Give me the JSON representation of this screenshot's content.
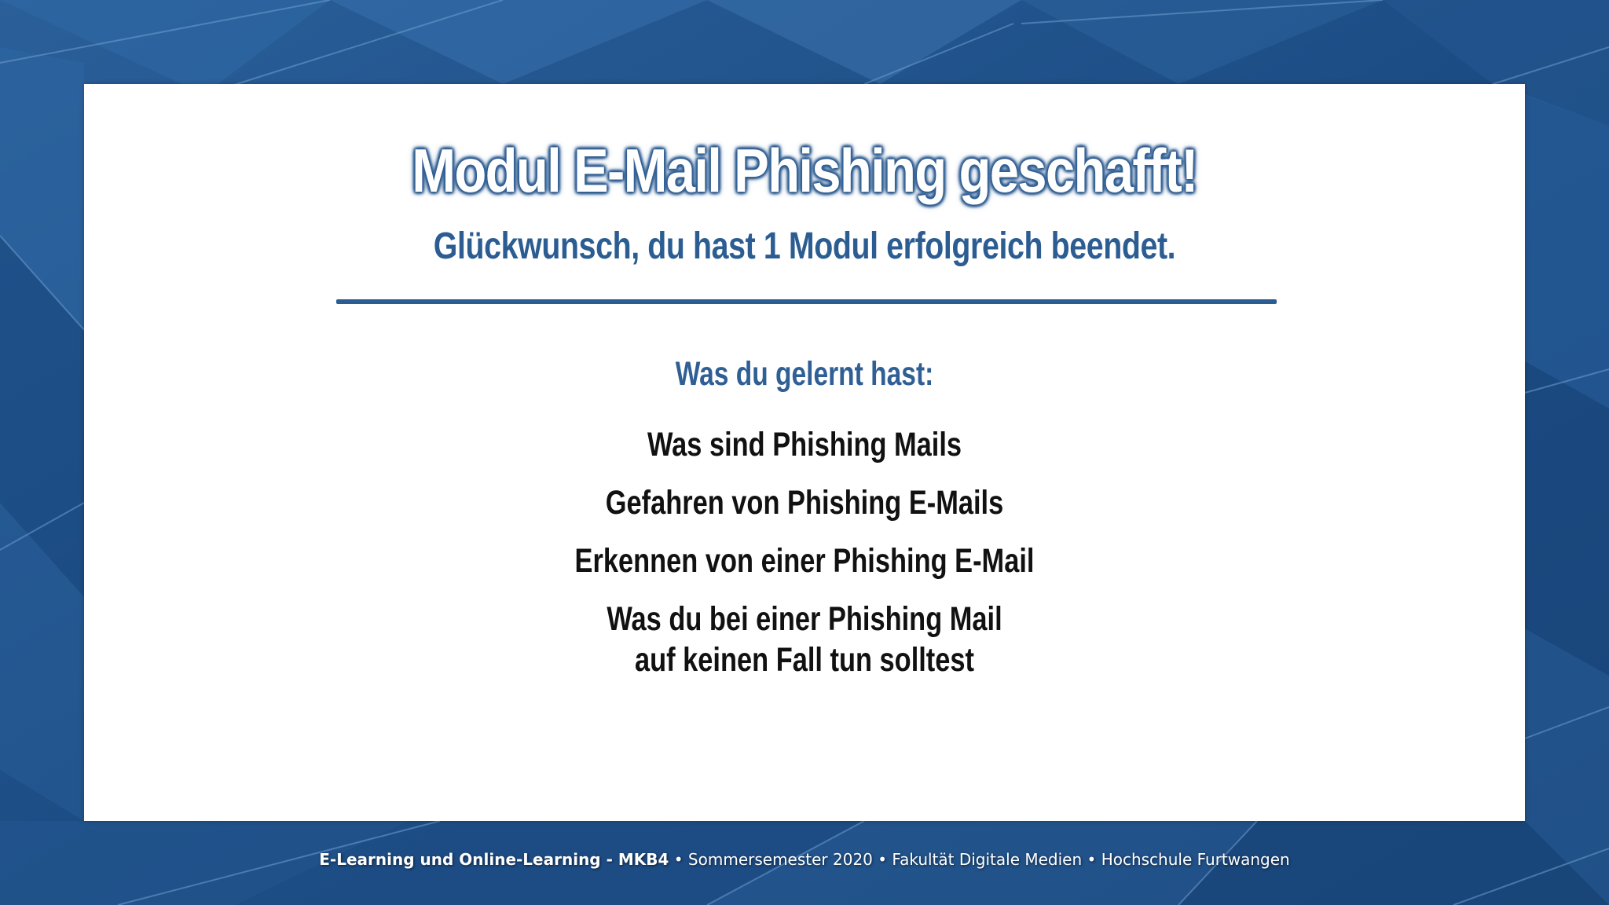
{
  "slide": {
    "title": "Modul E-Mail Phishing geschafft!",
    "subtitle": "Glückwunsch, du hast 1 Modul erfolgreich beendet.",
    "learned_heading": "Was du gelernt hast:",
    "learned_items": [
      {
        "lines": [
          "Was sind Phishing Mails"
        ]
      },
      {
        "lines": [
          "Gefahren von Phishing E-Mails"
        ]
      },
      {
        "lines": [
          "Erkennen von einer Phishing E-Mail"
        ]
      },
      {
        "lines": [
          "Was du bei einer Phishing Mail",
          "auf keinen Fall tun solltest"
        ]
      }
    ]
  },
  "footer": {
    "course": "E-Learning und Online-Learning - MKB4",
    "bullet": "•",
    "semester": "Sommersemester 2020",
    "faculty": "Fakultät Digitale Medien",
    "university": "Hochschule Furtwangen"
  },
  "colors": {
    "background": "#1d4f86",
    "accent": "#2c5d92",
    "card": "#ffffff",
    "item_text": "#111111"
  }
}
